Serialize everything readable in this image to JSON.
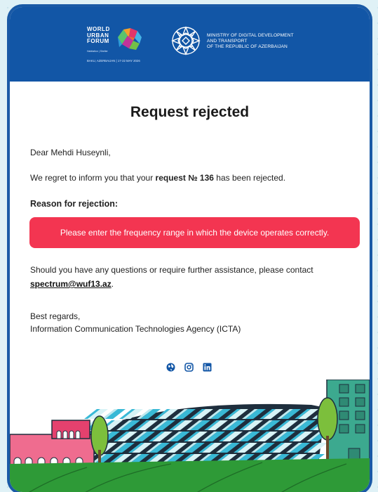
{
  "header": {
    "wuf_title": "WORLD\nURBAN\nFORUM",
    "wuf_sub": "Habitation | Shelter",
    "wuf_location": "BAKU, AZERBAIJAN | 17-22 MAY 2026",
    "ministry_name": "MINISTRY OF DIGITAL DEVELOPMENT\nAND TRANSPORT\nOF THE REPUBLIC OF AZERBAIJAN"
  },
  "title": "Request rejected",
  "greeting": "Dear Mehdi Huseynli,",
  "inform_prefix": "We regret to inform you that your ",
  "inform_request": "request № 136",
  "inform_suffix": " has been rejected.",
  "reason_heading": "Reason for rejection:",
  "reason_text": "Please enter the frequency range in which the device operates correctly.",
  "contact_text": "Should you have any questions or require further assistance, please contact ",
  "contact_email": "spectrum@wuf13.az",
  "contact_end": ".",
  "regards": "Best regards,",
  "agency": "Information Communication Technologies Agency (ICTA)",
  "social_icons": [
    "globe-icon",
    "instagram-icon",
    "linkedin-icon"
  ],
  "colors": {
    "header_bg": "#1256a6",
    "reason_bg": "#f33551",
    "card_border": "#1a5aa6"
  }
}
